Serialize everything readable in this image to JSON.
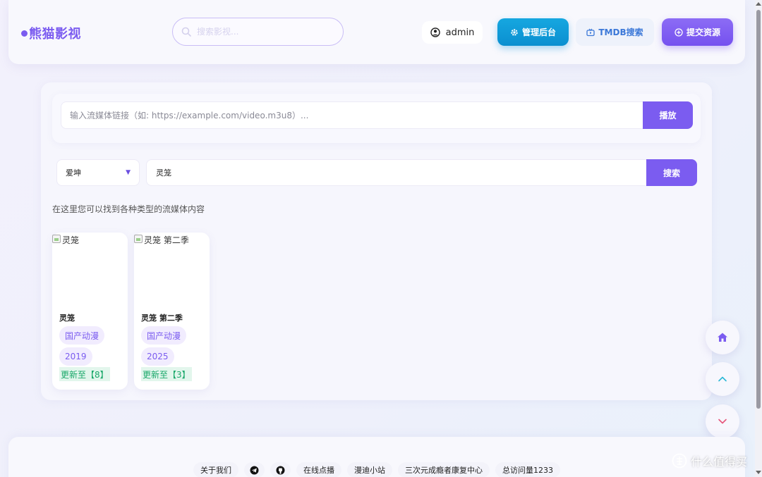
{
  "header": {
    "logo": "熊猫影视",
    "search_placeholder": "搜索影视...",
    "user": "admin",
    "admin_button": "管理后台",
    "tmdb_button": "TMDB搜索",
    "submit_button": "提交资源"
  },
  "stream": {
    "placeholder": "输入流媒体链接（如: https://example.com/video.m3u8）...",
    "play_button": "播放"
  },
  "search": {
    "source": "爱坤",
    "query": "灵笼",
    "button": "搜索"
  },
  "hint": "在这里您可以找到各种类型的流媒体内容",
  "results": [
    {
      "alt": "灵笼",
      "title": "灵笼",
      "genre": "国产动漫",
      "year": "2019",
      "update": "更新至【8】"
    },
    {
      "alt": "灵笼 第二季",
      "title": "灵笼 第二季",
      "genre": "国产动漫",
      "year": "2025",
      "update": "更新至【3】"
    }
  ],
  "footer": {
    "about": "关于我们",
    "telegram_icon": "telegram-icon",
    "github_icon": "github-icon",
    "vod": "在线点播",
    "manga": "漫迪小站",
    "rehab": "三次元成瘾者康复中心",
    "visits": "总访问量1233"
  },
  "watermark": "什么值得买",
  "colors": {
    "accent": "#7b5cf0",
    "admin_blue": "#0a8fd0",
    "tmdb_text": "#3b78d8",
    "update_green": "#1aa86a"
  }
}
